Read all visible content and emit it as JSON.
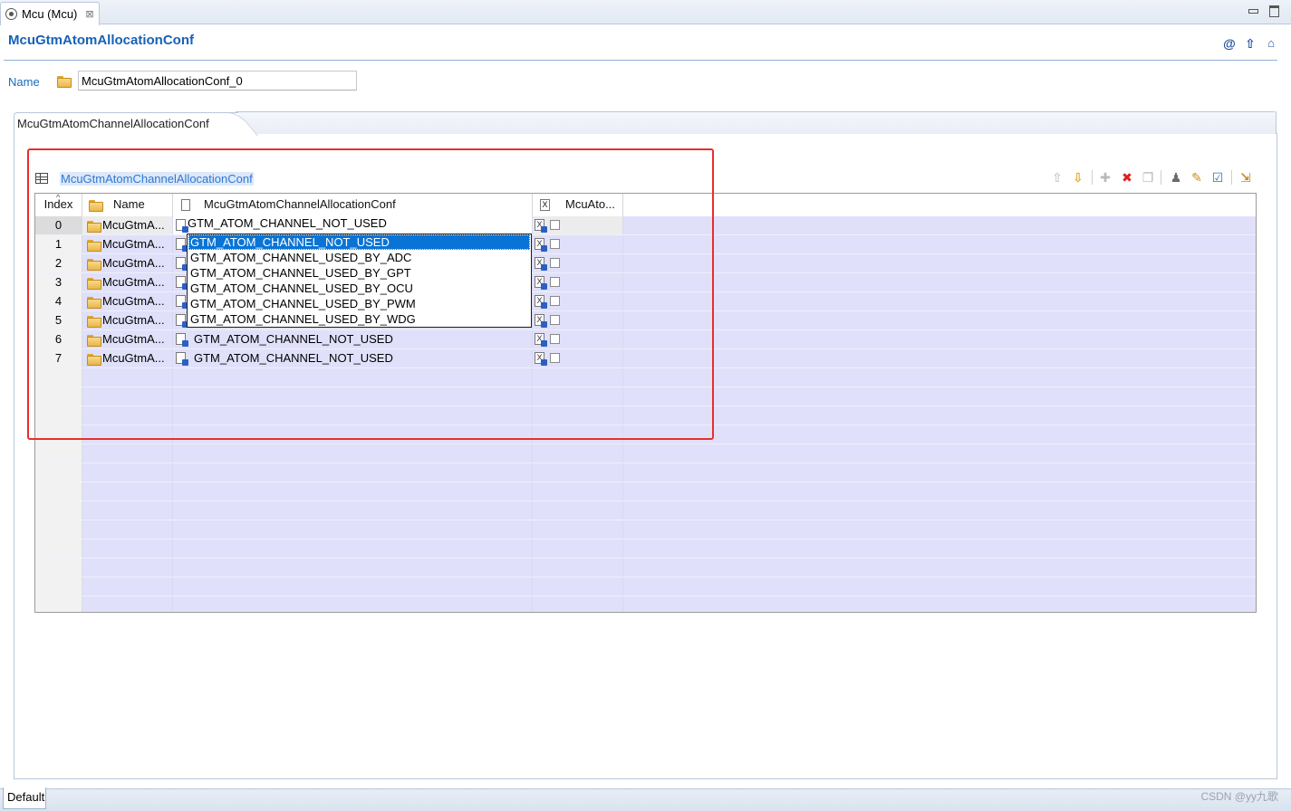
{
  "editor_tab": {
    "label": "Mcu (Mcu)",
    "close": "⊠"
  },
  "page": {
    "title": "McuGtmAtomAllocationConf"
  },
  "header_icons": [
    "at-icon",
    "up-arrow-icon",
    "home-icon"
  ],
  "name_field": {
    "label": "Name",
    "value": "McuGtmAtomAllocationConf_0"
  },
  "subtab": {
    "label": "McuGtmAtomChannelAllocationConf"
  },
  "section": {
    "title": "McuGtmAtomChannelAllocationConf"
  },
  "table": {
    "headers": {
      "index": "Index",
      "name": "Name",
      "conf": "McuGtmAtomChannelAllocationConf",
      "mcu": "McuAto..."
    },
    "rows": [
      {
        "index": "0",
        "name": "McuGtmA...",
        "conf": "GTM_ATOM_CHANNEL_NOT_USED"
      },
      {
        "index": "1",
        "name": "McuGtmA...",
        "conf": ""
      },
      {
        "index": "2",
        "name": "McuGtmA...",
        "conf": ""
      },
      {
        "index": "3",
        "name": "McuGtmA...",
        "conf": ""
      },
      {
        "index": "4",
        "name": "McuGtmA...",
        "conf": ""
      },
      {
        "index": "5",
        "name": "McuGtmA...",
        "conf": ""
      },
      {
        "index": "6",
        "name": "McuGtmA...",
        "conf": "GTM_ATOM_CHANNEL_NOT_USED"
      },
      {
        "index": "7",
        "name": "McuGtmA...",
        "conf": "GTM_ATOM_CHANNEL_NOT_USED"
      }
    ]
  },
  "combo": {
    "value": "GTM_ATOM_CHANNEL_NOT_USED",
    "options": [
      "GTM_ATOM_CHANNEL_NOT_USED",
      "GTM_ATOM_CHANNEL_USED_BY_ADC",
      "GTM_ATOM_CHANNEL_USED_BY_GPT",
      "GTM_ATOM_CHANNEL_USED_BY_OCU",
      "GTM_ATOM_CHANNEL_USED_BY_PWM",
      "GTM_ATOM_CHANNEL_USED_BY_WDG"
    ],
    "selected_index": 0
  },
  "bottom": {
    "tab": "Default",
    "watermark": "CSDN @yy九歌"
  },
  "colors": {
    "accent": "#1561b8",
    "highlight": "#e8302b",
    "row_fill": "#e0e0fa",
    "selection": "#0a74d6"
  }
}
